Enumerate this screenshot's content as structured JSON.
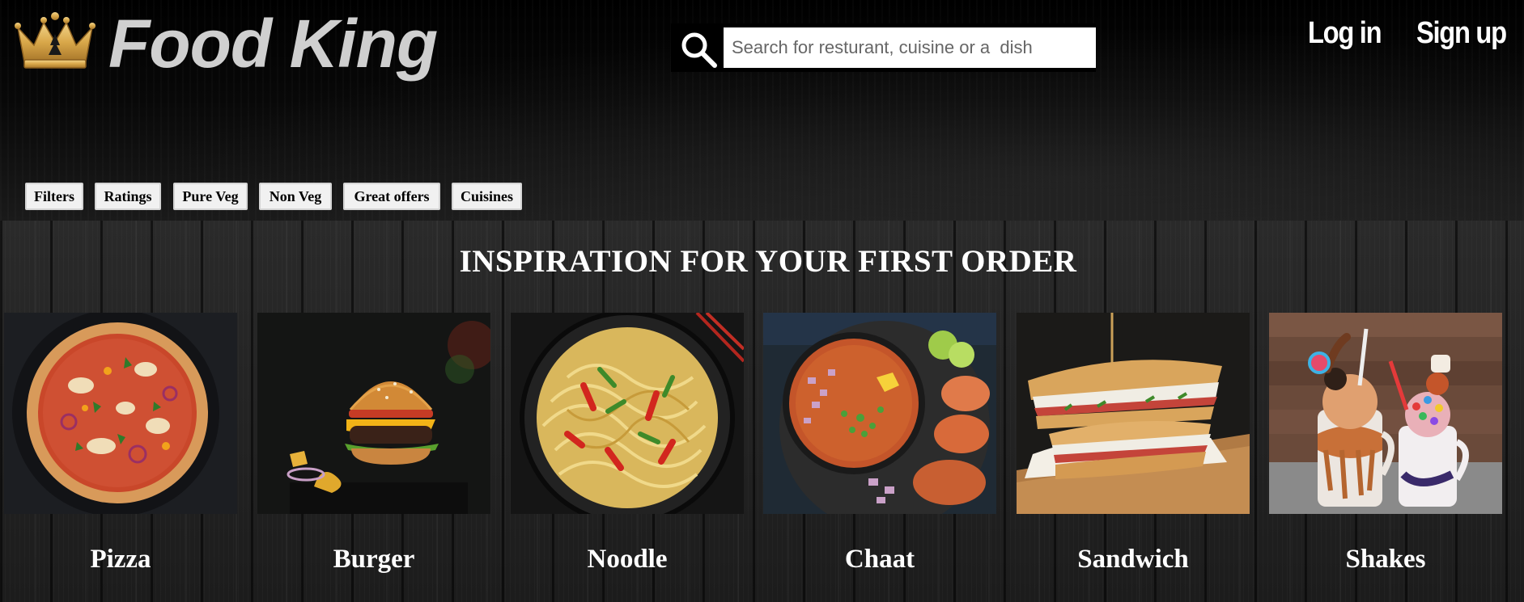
{
  "header": {
    "brand": "Food King",
    "logo_icon": "crown-icon",
    "search": {
      "icon": "search-icon",
      "placeholder": "Search for resturant, cuisine or a  dish",
      "value": ""
    },
    "auth": {
      "login": "Log in",
      "signup": "Sign up"
    },
    "filters": [
      "Filters",
      "Ratings",
      "Pure Veg",
      "Non Veg",
      "Great offers",
      "Cuisines"
    ]
  },
  "main": {
    "title": "INSPIRATION FOR YOUR FIRST ORDER",
    "categories": [
      {
        "label": "Pizza"
      },
      {
        "label": "Burger"
      },
      {
        "label": "Noodle"
      },
      {
        "label": "Chaat"
      },
      {
        "label": "Sandwich"
      },
      {
        "label": "Shakes"
      }
    ]
  },
  "colors": {
    "background": "#0b0b0b",
    "brand_text": "#cfcfcf",
    "crown_gold": "#d9a84a",
    "title_text": "#ffffff",
    "filter_bg": "#f1f1f1"
  }
}
